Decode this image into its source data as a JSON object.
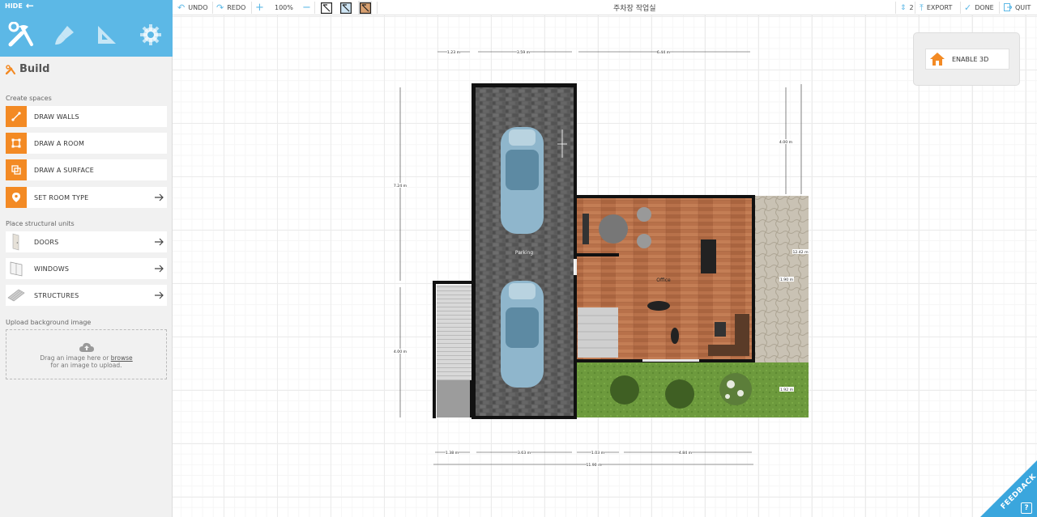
{
  "sidebar": {
    "hide_label": "HIDE",
    "mode_tabs": [
      "build",
      "paint",
      "measure",
      "settings"
    ],
    "section_title": "Build",
    "create_spaces_label": "Create spaces",
    "create_items": [
      {
        "label": "DRAW WALLS",
        "icon": "draw-walls-icon"
      },
      {
        "label": "DRAW A ROOM",
        "icon": "draw-room-icon"
      },
      {
        "label": "DRAW A SURFACE",
        "icon": "draw-surface-icon"
      },
      {
        "label": "SET ROOM TYPE",
        "icon": "location-pin-icon"
      }
    ],
    "structural_label": "Place structural units",
    "structural_items": [
      {
        "label": "DOORS",
        "icon": "door-icon"
      },
      {
        "label": "WINDOWS",
        "icon": "window-icon"
      },
      {
        "label": "STRUCTURES",
        "icon": "stairs-icon"
      }
    ],
    "upload_label": "Upload background image",
    "upload_text_1": "Drag an image here or",
    "upload_browse": "browse",
    "upload_text_2": "for an image to upload."
  },
  "toolbar": {
    "undo": "UNDO",
    "redo": "REDO",
    "zoom": "100%",
    "title": "주차장 작업실",
    "floor": "2",
    "export": "EXPORT",
    "done": "DONE",
    "quit": "QUIT"
  },
  "enable3d": "ENABLE 3D",
  "feedback": "FEEDBACK",
  "help": "?",
  "plan": {
    "rooms": {
      "parking": "Parking",
      "office": "Office"
    },
    "dimensions": {
      "top": [
        "1.23 m",
        "3.59 m",
        "6.44 m"
      ],
      "bottom": [
        "1.38 m",
        "3.63 m",
        "1.03 m",
        "4.84 m"
      ],
      "total": "11.90 m",
      "left": [
        "7.24 m",
        "4.00 m"
      ],
      "right_outer": "4.00 m",
      "right": [
        "12.42 m",
        "1.90 m",
        "1.92 m"
      ]
    }
  },
  "colors": {
    "accent": "#5cb8e6",
    "orange": "#f38a24",
    "sidebar_bg": "#f1f1f1",
    "feedback": "#3aa6dd"
  }
}
